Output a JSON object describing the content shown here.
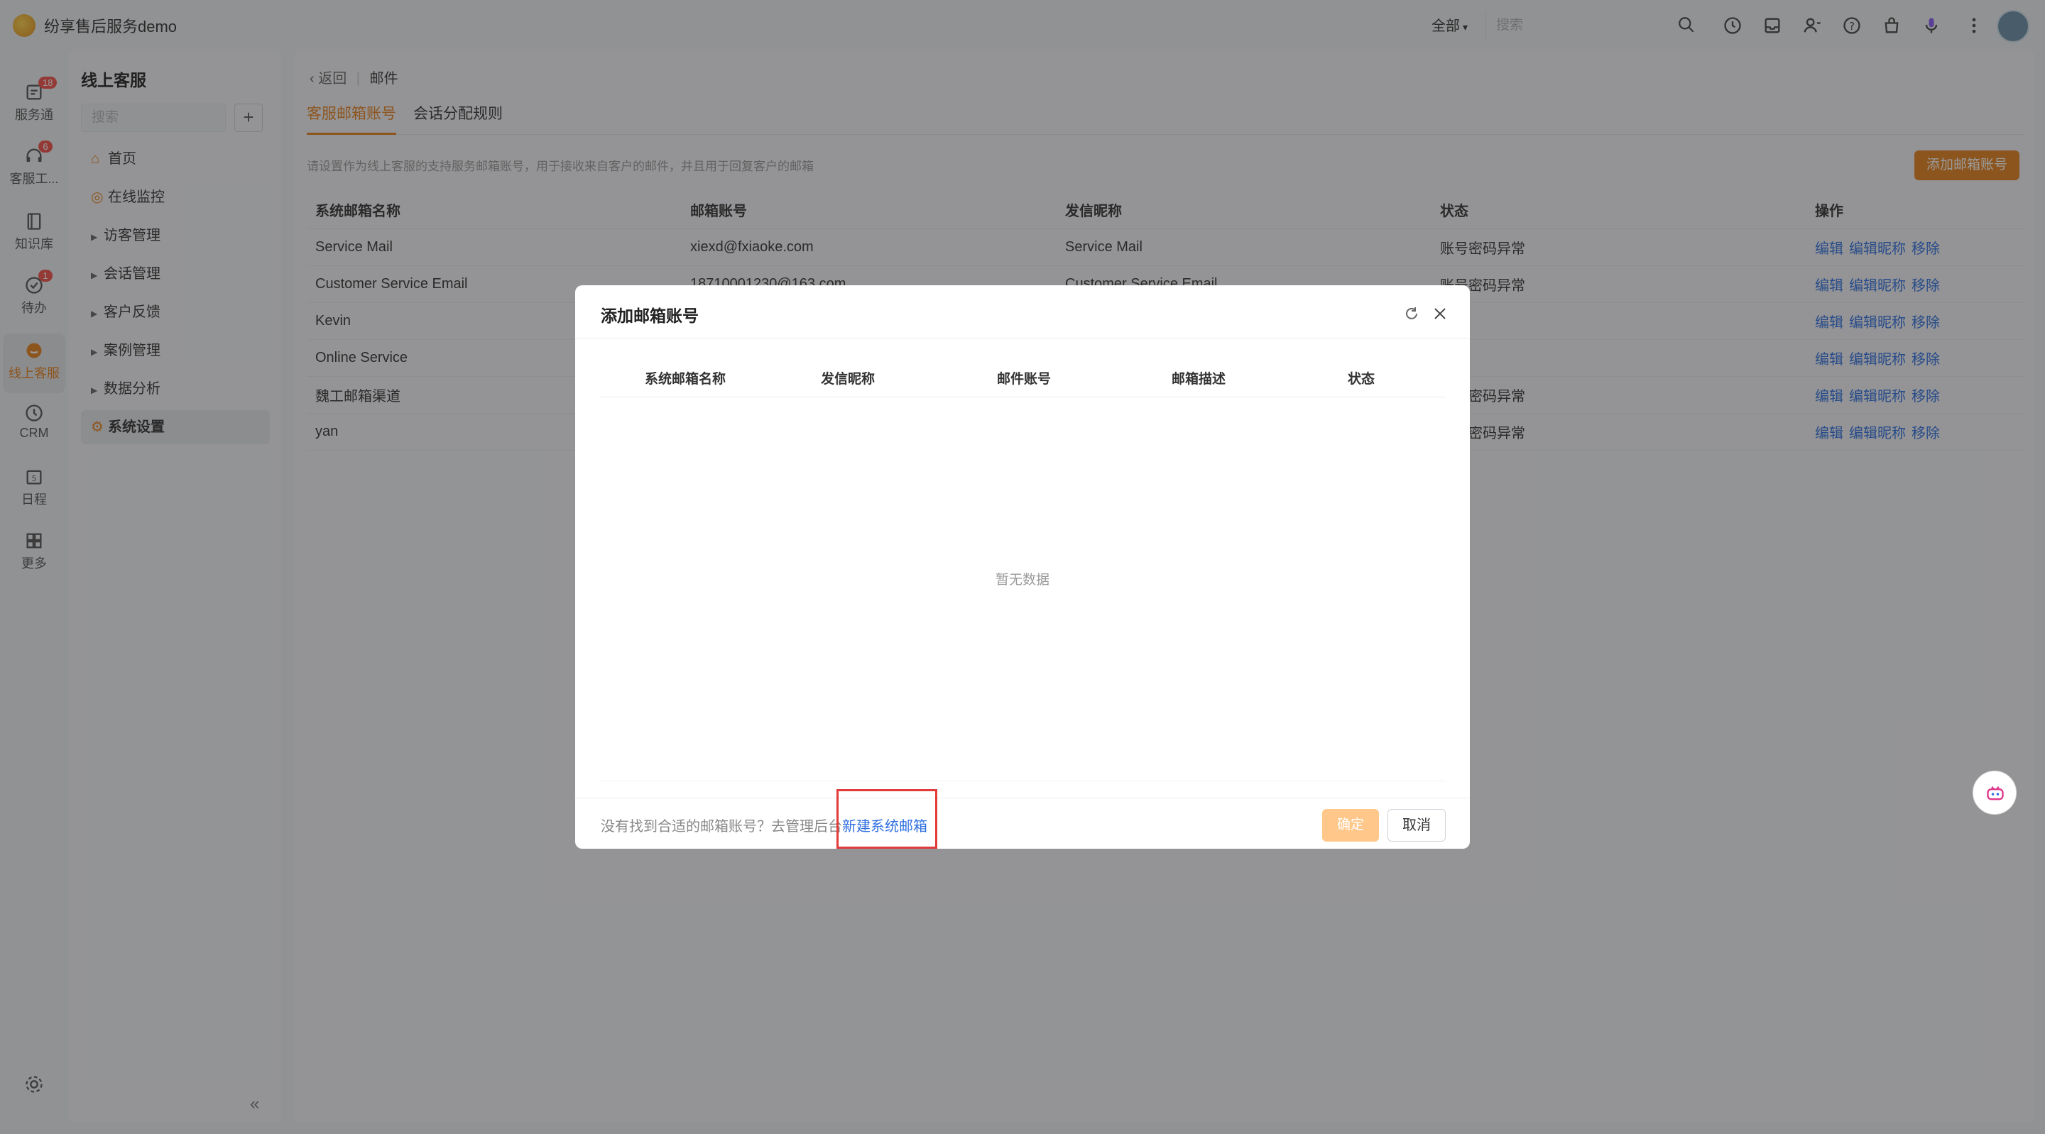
{
  "app": {
    "title": "纷享售后服务demo"
  },
  "topbar": {
    "scope": "全部",
    "search_placeholder": "搜索",
    "icons": [
      "clock-icon",
      "inbox-icon",
      "contacts-icon",
      "help-icon",
      "bag-icon",
      "mic-icon",
      "more-icon"
    ]
  },
  "rail": {
    "items": [
      {
        "label": "服务通",
        "badge": "18",
        "icon": "service-icon"
      },
      {
        "label": "客服工...",
        "badge": "6",
        "icon": "headset-icon"
      },
      {
        "label": "知识库",
        "badge": "",
        "icon": "book-icon"
      },
      {
        "label": "待办",
        "badge": "1",
        "icon": "todo-icon"
      },
      {
        "label": "线上客服",
        "badge": "",
        "icon": "chat-icon",
        "active": true
      },
      {
        "label": "CRM",
        "badge": "",
        "icon": "crm-icon"
      },
      {
        "label": "日程",
        "badge": "",
        "icon": "calendar-icon"
      },
      {
        "label": "更多",
        "badge": "",
        "icon": "grid-icon"
      }
    ]
  },
  "nav": {
    "title": "线上客服",
    "search_placeholder": "搜索",
    "items": [
      {
        "label": "首页",
        "icon": "home-icon"
      },
      {
        "label": "在线监控",
        "icon": "monitor-icon"
      },
      {
        "label": "访客管理",
        "icon": "arrow"
      },
      {
        "label": "会话管理",
        "icon": "arrow"
      },
      {
        "label": "客户反馈",
        "icon": "arrow"
      },
      {
        "label": "案例管理",
        "icon": "arrow"
      },
      {
        "label": "数据分析",
        "icon": "arrow"
      },
      {
        "label": "系统设置",
        "icon": "gear-icon",
        "active": true
      }
    ]
  },
  "main": {
    "back": "返回",
    "page": "邮件",
    "tabs": [
      "客服邮箱账号",
      "会话分配规则"
    ],
    "hint": "请设置作为线上客服的支持服务邮箱账号，用于接收来自客户的邮件，并且用于回复客户的邮箱",
    "add_button": "添加邮箱账号",
    "columns": [
      "系统邮箱名称",
      "邮箱账号",
      "发信昵称",
      "状态",
      "操作"
    ],
    "rows": [
      {
        "name": "Service Mail",
        "account": "xiexd@fxiaoke.com",
        "nick": "Service Mail",
        "status": "账号密码异常"
      },
      {
        "name": "Customer Service Email",
        "account": "18710001230@163.com",
        "nick": "Customer Service Email",
        "status": "账号密码异常"
      },
      {
        "name": "Kevin",
        "account": "",
        "nick": "",
        "status": ""
      },
      {
        "name": "Online Service",
        "account": "",
        "nick": "",
        "status": ""
      },
      {
        "name": "魏工邮箱渠道",
        "account": "",
        "nick": "",
        "status": "账号密码异常"
      },
      {
        "name": "yan",
        "account": "",
        "nick": "",
        "status": "账号密码异常"
      }
    ],
    "ops": [
      "编辑",
      "编辑昵称",
      "移除"
    ]
  },
  "dialog": {
    "title": "添加邮箱账号",
    "columns": [
      "系统邮箱名称",
      "发信昵称",
      "邮件账号",
      "邮箱描述",
      "状态"
    ],
    "empty": "暂无数据",
    "footer_text": "没有找到合适的邮箱账号？去管理后台",
    "footer_link": "新建系统邮箱",
    "ok": "确定",
    "cancel": "取消",
    "highlight_color": "#e23b3b"
  },
  "colors": {
    "accent": "#e8821e",
    "link": "#2f6fe0"
  }
}
